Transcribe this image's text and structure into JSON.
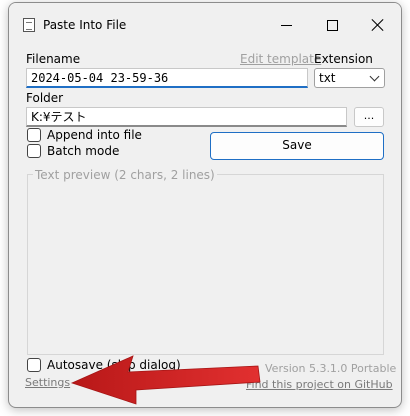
{
  "window": {
    "title": "Paste Into File"
  },
  "form": {
    "filename_label": "Filename",
    "filename_value": "2024-05-04 23-59-36",
    "edit_template_label": "Edit template",
    "extension_label": "Extension",
    "extension_value": "txt",
    "folder_label": "Folder",
    "folder_value": "K:¥テスト",
    "browse_label": "...",
    "append_label": "Append into file",
    "batch_label": "Batch mode",
    "save_label": "Save",
    "preview_label": "Text preview (2 chars, 2 lines)",
    "autosave_label": "Autosave (skip dialog)",
    "version_text": "Version 5.3.1.0 Portable",
    "settings_label": "Settings",
    "github_label": "Find this project on GitHub"
  },
  "colors": {
    "accent": "#1f6fc5",
    "annotation_arrow": "#d42323"
  },
  "icons": {
    "app": "document-icon",
    "minimize": "minimize-icon",
    "maximize": "maximize-icon",
    "close": "close-icon",
    "dropdown": "chevron-down-icon"
  }
}
